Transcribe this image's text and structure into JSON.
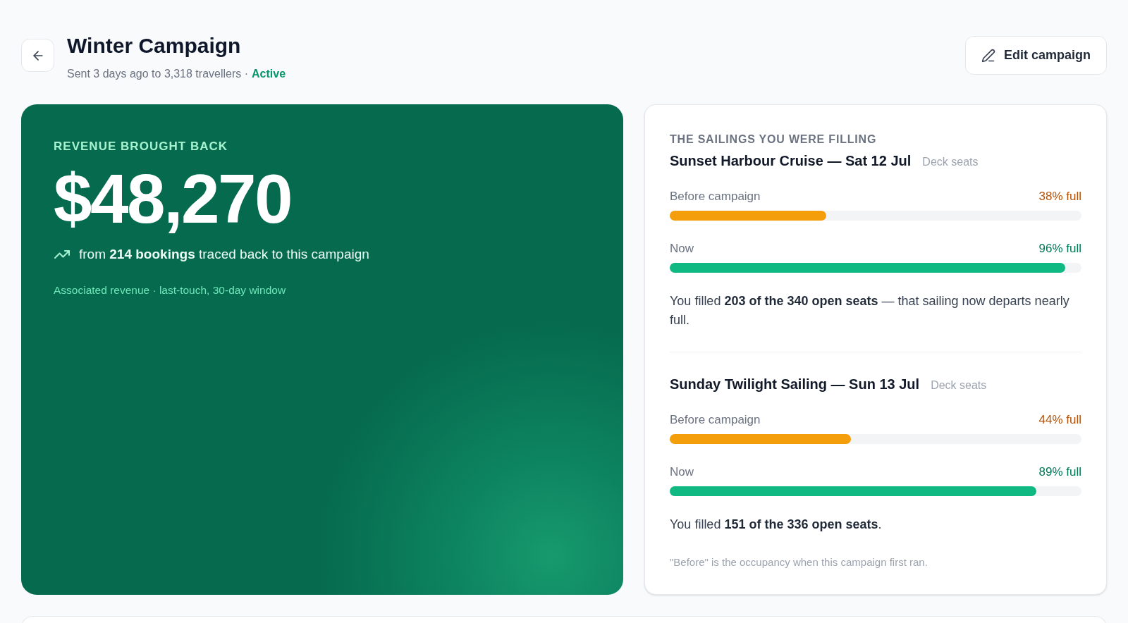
{
  "header": {
    "title": "Winter Campaign",
    "subtitle": "Sent 3 days ago to 3,318 travellers ·",
    "status": "Active",
    "edit_button": "Edit campaign"
  },
  "revenue_card": {
    "label": "REVENUE BROUGHT BACK",
    "amount": "$48,270",
    "detail": "from **214 bookings** traced back to this campaign",
    "note": "Associated revenue · last-touch, 30-day window"
  },
  "sailings_panel": {
    "heading": "THE SAILINGS YOU WERE FILLING",
    "sailings": [
      {
        "name": "Sunset Harbour Cruise — Sat 12 Jul",
        "seat_type": "Deck seats",
        "bars": [
          {
            "kind": "before",
            "label": "Before campaign",
            "reading": "38% full",
            "level": 0.38
          },
          {
            "kind": "now",
            "label": "Now",
            "reading": "96% full",
            "level": 0.96
          }
        ],
        "summary": "You filled **203 of the 340 open seats** — that sailing now departs nearly full."
      },
      {
        "name": "Sunday Twilight Sailing — Sun 13 Jul",
        "seat_type": "Deck seats",
        "bars": [
          {
            "kind": "before",
            "label": "Before campaign",
            "reading": "44% full",
            "level": 0.44
          },
          {
            "kind": "now",
            "label": "Now",
            "reading": "89% full",
            "level": 0.89
          }
        ],
        "summary": "You filled **151 of the 336 open seats**."
      }
    ],
    "footnote": "\"Before\" is the occupancy when this campaign first ran."
  }
}
